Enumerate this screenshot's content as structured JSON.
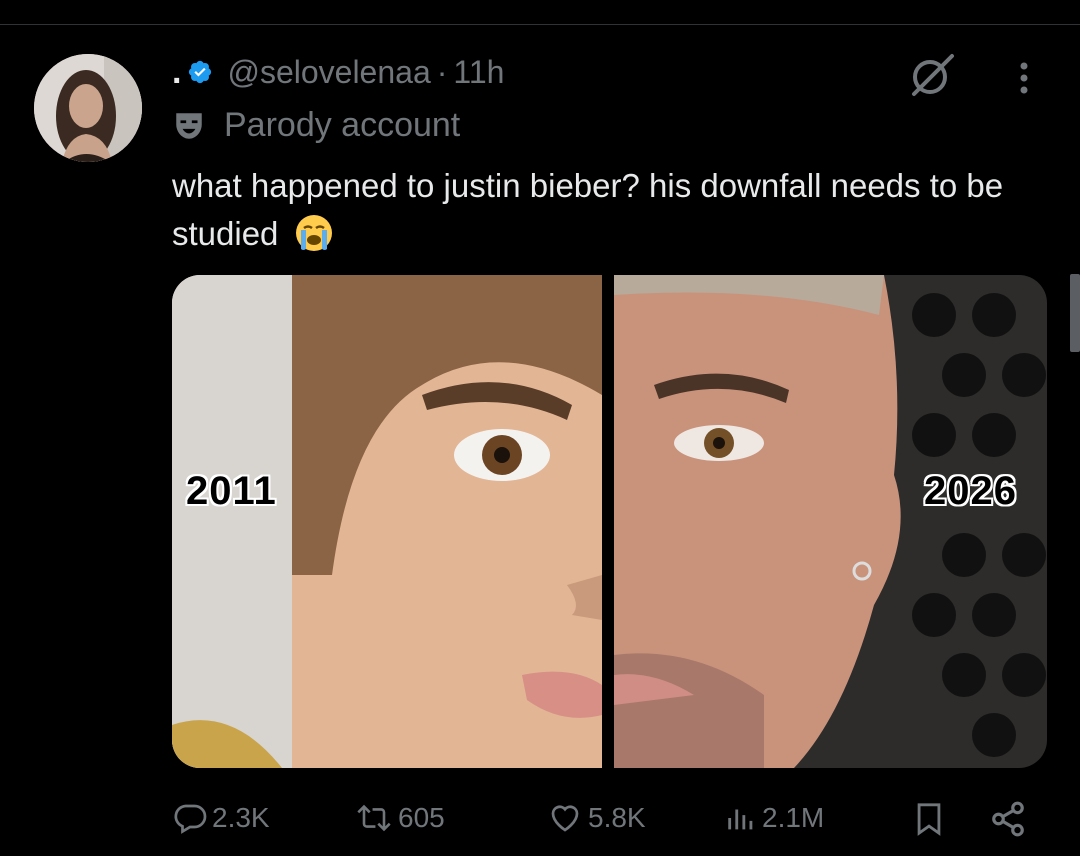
{
  "post": {
    "display_name": ".",
    "handle": "@selovelenaa",
    "separator": "·",
    "time": "11h",
    "account_label": "Parody account",
    "text": "what happened to justin bieber? his downfall needs to be studied",
    "emoji": "loudly-crying-face"
  },
  "media": {
    "left_label": "2011",
    "right_label": "2026"
  },
  "stats": {
    "replies": "2.3K",
    "reposts": "605",
    "likes": "5.8K",
    "views": "2.1M"
  },
  "colors": {
    "background": "#000000",
    "text": "#e7e9ea",
    "secondary": "#71767b",
    "verified": "#1d9bf0"
  }
}
